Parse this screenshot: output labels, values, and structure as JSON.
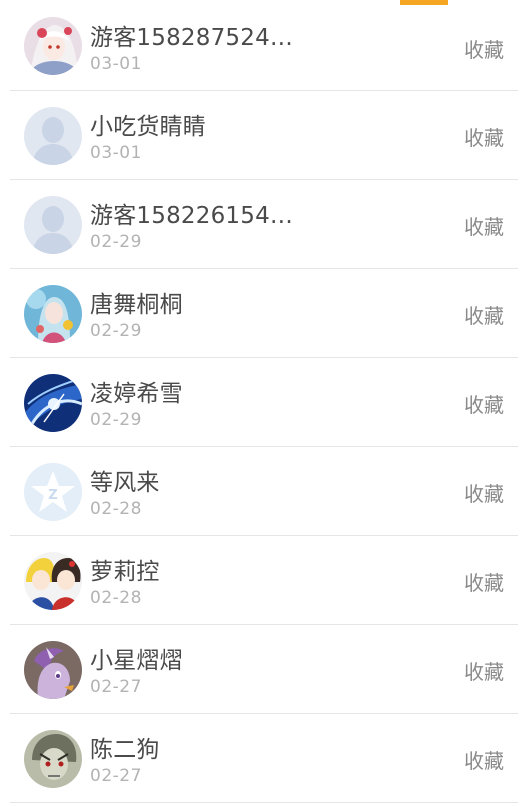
{
  "users": [
    {
      "name": "游客158287524…",
      "date": "03-01",
      "action": "收藏",
      "avatar": "anime-girl-avatar"
    },
    {
      "name": "小吃货睛睛",
      "date": "03-01",
      "action": "收藏",
      "avatar": "default-avatar"
    },
    {
      "name": "游客158226154…",
      "date": "02-29",
      "action": "收藏",
      "avatar": "default-avatar"
    },
    {
      "name": "唐舞桐桐",
      "date": "02-29",
      "action": "收藏",
      "avatar": "anime-girl-avatar"
    },
    {
      "name": "凌婷希雪",
      "date": "02-29",
      "action": "收藏",
      "avatar": "blue-art-avatar"
    },
    {
      "name": "等风来",
      "date": "02-28",
      "action": "收藏",
      "avatar": "qzone-star-avatar"
    },
    {
      "name": "萝莉控",
      "date": "02-28",
      "action": "收藏",
      "avatar": "anime-duo-avatar"
    },
    {
      "name": "小星熠熠",
      "date": "02-27",
      "action": "收藏",
      "avatar": "pony-avatar"
    },
    {
      "name": "陈二狗",
      "date": "02-27",
      "action": "收藏",
      "avatar": "sketch-face-avatar"
    }
  ],
  "colors": {
    "accent": "#f5a623",
    "divider": "#e6e6e6",
    "name_text": "#4a4a4a",
    "date_text": "#b3b3b3",
    "action_text": "#8a8a8a"
  }
}
